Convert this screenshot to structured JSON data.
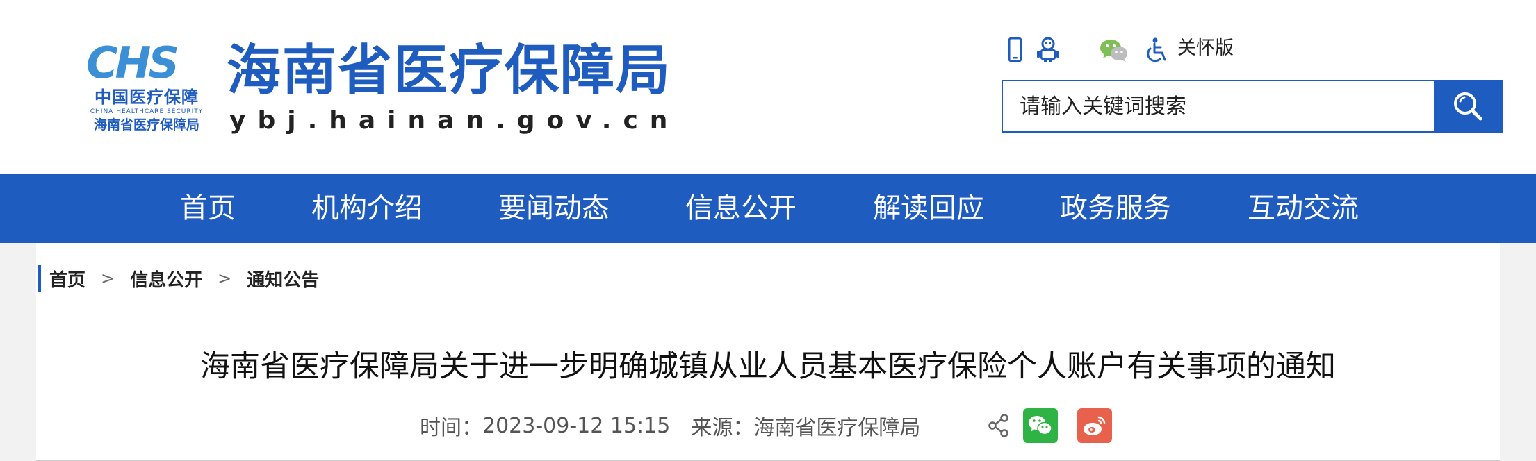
{
  "header": {
    "logo": {
      "mark_letters": "CHS",
      "mark_cn": "中国医疗保障",
      "mark_en": "CHINA HEALTHCARE SECURITY",
      "mark_sub": "海南省医疗保障局"
    },
    "site_name": "海南省医疗保障局",
    "site_url": "ybj.hainan.gov.cn",
    "tools": {
      "icons": [
        "mobile-icon",
        "robot-icon",
        "wechat-icon",
        "accessibility-icon"
      ],
      "care_label": "关怀版"
    },
    "search": {
      "placeholder": "请输入关键词搜索"
    }
  },
  "nav": {
    "items": [
      {
        "label": "首页"
      },
      {
        "label": "机构介绍"
      },
      {
        "label": "要闻动态"
      },
      {
        "label": "信息公开"
      },
      {
        "label": "解读回应"
      },
      {
        "label": "政务服务"
      },
      {
        "label": "互动交流"
      }
    ]
  },
  "breadcrumb": {
    "items": [
      {
        "label": "首页"
      },
      {
        "label": "信息公开"
      },
      {
        "label": "通知公告"
      }
    ],
    "separator": ">"
  },
  "article": {
    "title": "海南省医疗保障局关于进一步明确城镇从业人员基本医疗保险个人账户有关事项的通知",
    "time_label": "时间：",
    "time": "2023-09-12 15:15",
    "source_label": "来源：",
    "source": "海南省医疗保障局",
    "share_icons": [
      "share-icon",
      "wechat-share-icon",
      "weibo-share-icon"
    ]
  },
  "colors": {
    "brand_blue": "#1f5cbf",
    "logo_light_blue": "#3a8fd6",
    "wechat_green": "#2fb344",
    "weibo_red": "#e8614d",
    "page_grey": "#f2f2f2"
  }
}
